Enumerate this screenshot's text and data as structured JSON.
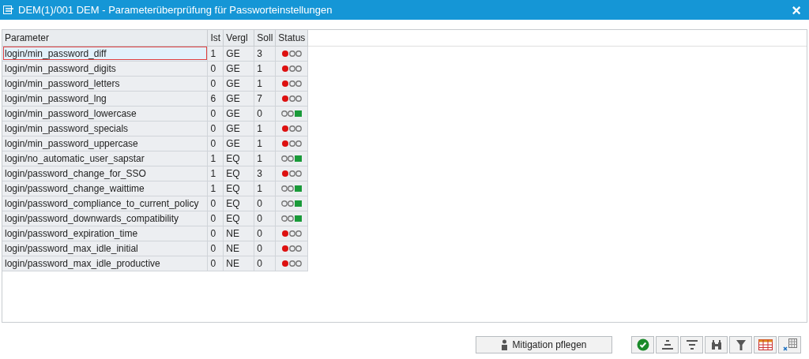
{
  "window": {
    "title": "DEM(1)/001 DEM - Parameterüberprüfung für Passworteinstellungen",
    "close": "×"
  },
  "table": {
    "columns": [
      "Parameter",
      "Ist",
      "Vergl",
      "Soll",
      "Status"
    ],
    "rows": [
      {
        "parameter": "login/min_password_diff",
        "ist": "1",
        "vergl": "GE",
        "soll": "3",
        "status_ok": false,
        "selected": true
      },
      {
        "parameter": "login/min_password_digits",
        "ist": "0",
        "vergl": "GE",
        "soll": "1",
        "status_ok": false,
        "selected": false
      },
      {
        "parameter": "login/min_password_letters",
        "ist": "0",
        "vergl": "GE",
        "soll": "1",
        "status_ok": false,
        "selected": false
      },
      {
        "parameter": "login/min_password_lng",
        "ist": "6",
        "vergl": "GE",
        "soll": "7",
        "status_ok": false,
        "selected": false
      },
      {
        "parameter": "login/min_password_lowercase",
        "ist": "0",
        "vergl": "GE",
        "soll": "0",
        "status_ok": true,
        "selected": false
      },
      {
        "parameter": "login/min_password_specials",
        "ist": "0",
        "vergl": "GE",
        "soll": "1",
        "status_ok": false,
        "selected": false
      },
      {
        "parameter": "login/min_password_uppercase",
        "ist": "0",
        "vergl": "GE",
        "soll": "1",
        "status_ok": false,
        "selected": false
      },
      {
        "parameter": "login/no_automatic_user_sapstar",
        "ist": "1",
        "vergl": "EQ",
        "soll": "1",
        "status_ok": true,
        "selected": false
      },
      {
        "parameter": "login/password_change_for_SSO",
        "ist": "1",
        "vergl": "EQ",
        "soll": "3",
        "status_ok": false,
        "selected": false
      },
      {
        "parameter": "login/password_change_waittime",
        "ist": "1",
        "vergl": "EQ",
        "soll": "1",
        "status_ok": true,
        "selected": false
      },
      {
        "parameter": "login/password_compliance_to_current_policy",
        "ist": "0",
        "vergl": "EQ",
        "soll": "0",
        "status_ok": true,
        "selected": false
      },
      {
        "parameter": "login/password_downwards_compatibility",
        "ist": "0",
        "vergl": "EQ",
        "soll": "0",
        "status_ok": true,
        "selected": false
      },
      {
        "parameter": "login/password_expiration_time",
        "ist": "0",
        "vergl": "NE",
        "soll": "0",
        "status_ok": false,
        "selected": false
      },
      {
        "parameter": "login/password_max_idle_initial",
        "ist": "0",
        "vergl": "NE",
        "soll": "0",
        "status_ok": false,
        "selected": false
      },
      {
        "parameter": "login/password_max_idle_productive",
        "ist": "0",
        "vergl": "NE",
        "soll": "0",
        "status_ok": false,
        "selected": false
      }
    ]
  },
  "footer": {
    "mitigation_button": "Mitigation pflegen",
    "toolbar": [
      {
        "kind": "check"
      },
      {
        "kind": "sort-asc"
      },
      {
        "kind": "sort-desc"
      },
      {
        "kind": "find"
      },
      {
        "kind": "filter"
      },
      {
        "kind": "layout"
      },
      {
        "kind": "export"
      }
    ]
  }
}
